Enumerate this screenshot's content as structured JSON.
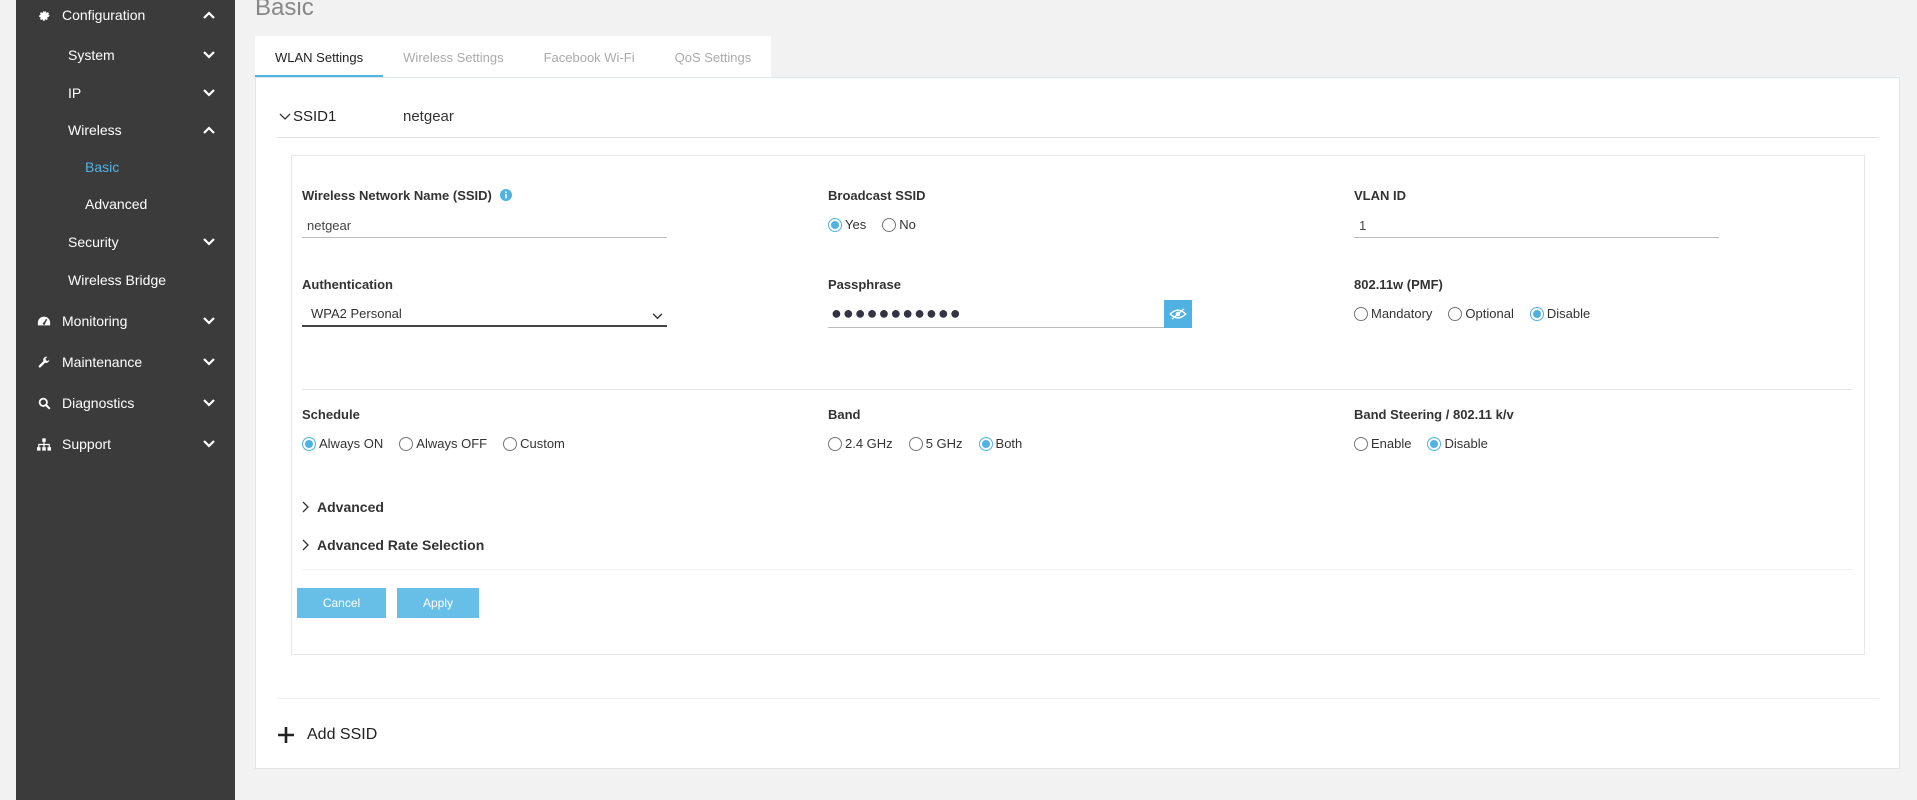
{
  "sidebar": {
    "items": [
      {
        "label": "Configuration",
        "icon": "gear-icon"
      },
      {
        "label": "System"
      },
      {
        "label": "IP"
      },
      {
        "label": "Wireless"
      },
      {
        "label": "Basic"
      },
      {
        "label": "Advanced"
      },
      {
        "label": "Security"
      },
      {
        "label": "Wireless Bridge"
      },
      {
        "label": "Monitoring",
        "icon": "dashboard-icon"
      },
      {
        "label": "Maintenance",
        "icon": "wrench-icon"
      },
      {
        "label": "Diagnostics",
        "icon": "search-icon"
      },
      {
        "label": "Support",
        "icon": "sitemap-icon"
      }
    ]
  },
  "page": {
    "title": "Basic"
  },
  "tabs": [
    {
      "label": "WLAN Settings"
    },
    {
      "label": "Wireless Settings"
    },
    {
      "label": "Facebook Wi-Fi"
    },
    {
      "label": "QoS Settings"
    }
  ],
  "ssid": {
    "label": "SSID1",
    "value": "netgear"
  },
  "form": {
    "ssid_name": {
      "label": "Wireless Network Name (SSID)",
      "value": "netgear"
    },
    "broadcast": {
      "label": "Broadcast SSID",
      "options": [
        "Yes",
        "No"
      ],
      "selected": "Yes"
    },
    "vlan": {
      "label": "VLAN ID",
      "value": "1"
    },
    "auth": {
      "label": "Authentication",
      "value": "WPA2 Personal"
    },
    "passphrase": {
      "label": "Passphrase",
      "masked": "●●●●●●●●●●●"
    },
    "pmf": {
      "label": "802.11w (PMF)",
      "options": [
        "Mandatory",
        "Optional",
        "Disable"
      ],
      "selected": "Disable"
    },
    "schedule": {
      "label": "Schedule",
      "options": [
        "Always ON",
        "Always OFF",
        "Custom"
      ],
      "selected": "Always ON"
    },
    "band": {
      "label": "Band",
      "options": [
        "2.4 GHz",
        "5 GHz",
        "Both"
      ],
      "selected": "Both"
    },
    "band_steering": {
      "label": "Band Steering / 802.11 k/v",
      "options": [
        "Enable",
        "Disable"
      ],
      "selected": "Disable"
    },
    "advanced_label": "Advanced",
    "rate_label": "Advanced Rate Selection",
    "cancel_label": "Cancel",
    "apply_label": "Apply"
  },
  "add_ssid_label": "Add SSID",
  "colors": {
    "accent": "#4fb2e3",
    "sidebar": "#3b3b3b",
    "button": "#67bfe8"
  }
}
